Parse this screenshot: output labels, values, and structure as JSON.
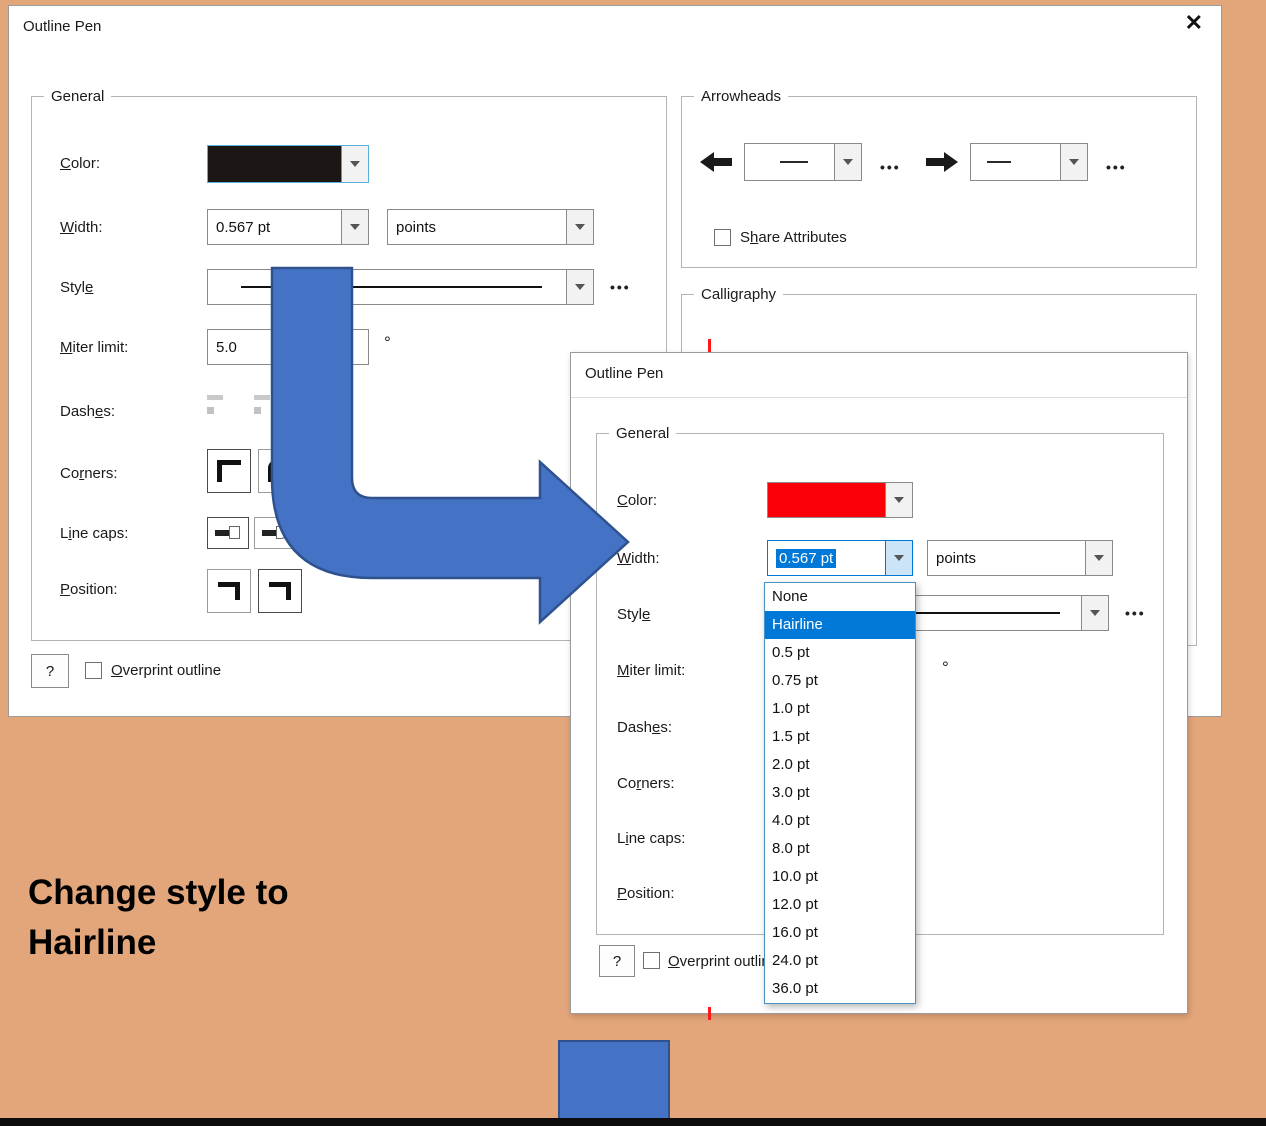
{
  "page": {
    "annotation_line1": "Change style to",
    "annotation_line2": "Hairline"
  },
  "colors": {
    "arrow_fill": "#4472c4",
    "arrow_stroke": "#2f528f",
    "selection_blue": "#0078d7",
    "swatch_black": "#1c1614",
    "swatch_red": "#fb0006",
    "background_salmon": "#e3a57a"
  },
  "back_dialog": {
    "title": "Outline Pen",
    "close": "✕",
    "general": {
      "legend": "General",
      "color_label": "Color:",
      "width_label": "Width:",
      "width_value": "0.567 pt",
      "width_units": "points",
      "style_label": "Style",
      "style_more": "•••",
      "miter_label": "Miter limit:",
      "miter_value": "5.0",
      "miter_degree": "°",
      "dashes_label": "Dashes:",
      "corners_label": "Corners:",
      "linecaps_label": "Line caps:",
      "position_label": "Position:"
    },
    "help": "?",
    "overprint_label": "Overprint outline",
    "arrowheads": {
      "legend": "Arrowheads",
      "more1": "•••",
      "more2": "•••",
      "share_label": "Share Attributes"
    },
    "calligraphy_legend": "Calligraphy"
  },
  "front_dialog": {
    "title": "Outline Pen",
    "general": {
      "legend": "General",
      "color_label": "Color:",
      "width_label": "Width:",
      "width_value": "0.567 pt",
      "width_units": "points",
      "style_label": "Style",
      "style_more": "•••",
      "miter_label": "Miter limit:",
      "miter_degree": "°",
      "dashes_label": "Dashes:",
      "corners_label": "Corners:",
      "linecaps_label": "Line caps:",
      "position_label": "Position:"
    },
    "help": "?",
    "overprint_label": "Overprint outline",
    "width_dropdown": {
      "items": [
        "None",
        "Hairline",
        "0.5 pt",
        "0.75 pt",
        "1.0 pt",
        "1.5 pt",
        "2.0 pt",
        "3.0 pt",
        "4.0 pt",
        "8.0 pt",
        "10.0 pt",
        "12.0 pt",
        "16.0 pt",
        "24.0 pt",
        "36.0 pt"
      ],
      "selected": "Hairline"
    }
  }
}
